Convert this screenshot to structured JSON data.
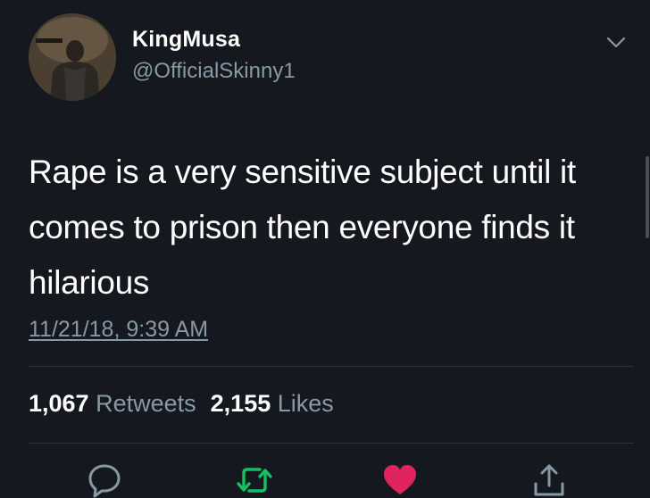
{
  "user": {
    "display_name": "KingMusa",
    "handle": "@OfficialSkinny1"
  },
  "tweet": {
    "text": "Rape is a very sensitive subject until it comes to prison then everyone finds it hilarious",
    "timestamp": "11/21/18, 9:39 AM"
  },
  "stats": {
    "retweets_count": "1,067",
    "retweets_label": "Retweets",
    "likes_count": "2,155",
    "likes_label": "Likes"
  },
  "icons": {
    "avatar": "avatar",
    "menu": "chevron-down-icon",
    "reply": "reply-icon",
    "retweet": "retweet-icon",
    "like": "heart-icon",
    "share": "share-icon"
  },
  "colors": {
    "background": "#15191f",
    "text": "#ffffff",
    "secondary_text": "#8899a6",
    "retweet_green": "#17bf63",
    "like_red": "#e0245e"
  }
}
